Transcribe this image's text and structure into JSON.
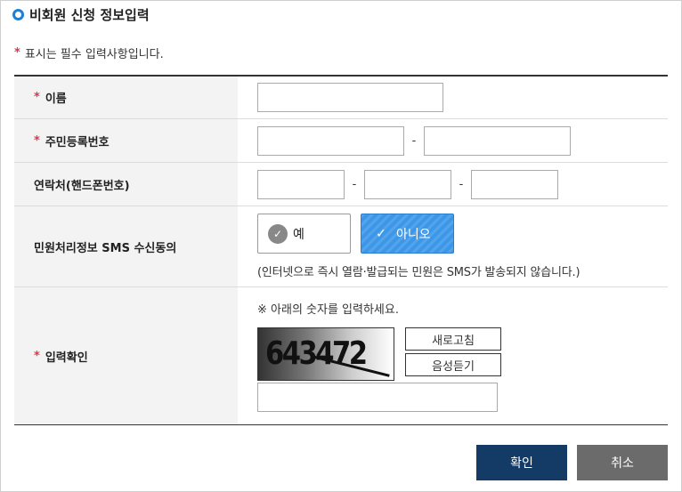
{
  "title": "비회원 신청 정보입력",
  "required_note": "표시는 필수 입력사항입니다.",
  "required_mark": "*",
  "fields": {
    "name_label": "이름",
    "rrn_label": "주민등록번호",
    "phone_label": "연락처(핸드폰번호)",
    "sms_label": "민원처리정보 SMS 수신동의",
    "captcha_label": "입력확인"
  },
  "separator": "-",
  "sms": {
    "yes_label": "예",
    "no_label": "아니오",
    "selected": "아니오",
    "note": "(인터넷으로 즉시 열람·발급되는 민원은 SMS가 발송되지 않습니다.)"
  },
  "captcha": {
    "note": "※ 아래의 숫자를 입력하세요.",
    "code": "643472",
    "refresh_label": "새로고침",
    "audio_label": "음성듣기"
  },
  "actions": {
    "confirm_label": "확인",
    "cancel_label": "취소"
  },
  "colors": {
    "accent": "#1f7fd4",
    "required": "#e3314b",
    "selected_option": "#3c97e8",
    "confirm_button": "#143b66",
    "cancel_button": "#6b6b6b"
  }
}
